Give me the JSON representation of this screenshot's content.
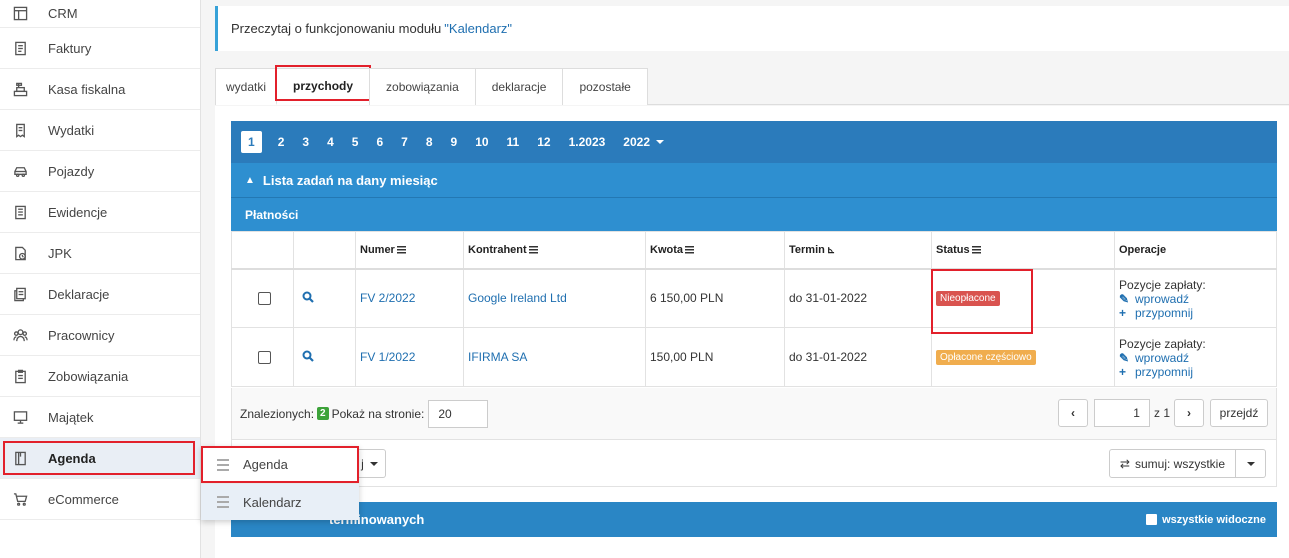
{
  "sidebar": {
    "items": [
      {
        "label": "CRM",
        "icon": "layout-icon"
      },
      {
        "label": "Faktury",
        "icon": "invoice-icon"
      },
      {
        "label": "Kasa fiskalna",
        "icon": "cash-register-icon"
      },
      {
        "label": "Wydatki",
        "icon": "receipt-icon"
      },
      {
        "label": "Pojazdy",
        "icon": "car-icon"
      },
      {
        "label": "Ewidencje",
        "icon": "ledger-icon"
      },
      {
        "label": "JPK",
        "icon": "jpk-file-icon"
      },
      {
        "label": "Deklaracje",
        "icon": "declaration-icon"
      },
      {
        "label": "Pracownicy",
        "icon": "employees-icon"
      },
      {
        "label": "Zobowiązania",
        "icon": "obligations-icon"
      },
      {
        "label": "Majątek",
        "icon": "monitor-icon"
      },
      {
        "label": "Agenda",
        "icon": "agenda-icon"
      },
      {
        "label": "eCommerce",
        "icon": "cart-icon"
      }
    ]
  },
  "submenu": {
    "items": [
      {
        "label": "Agenda"
      },
      {
        "label": "Kalendarz"
      }
    ]
  },
  "info": {
    "text": "Przeczytaj o funkcjonowaniu modułu",
    "link": "\"Kalendarz\""
  },
  "tabs": [
    {
      "label": "wydatki"
    },
    {
      "label": "przychody"
    },
    {
      "label": "zobowiązania"
    },
    {
      "label": "deklaracje"
    },
    {
      "label": "pozostałe"
    }
  ],
  "months": [
    "1",
    "2",
    "3",
    "4",
    "5",
    "6",
    "7",
    "8",
    "9",
    "10",
    "11",
    "12",
    "1.2023",
    "2022"
  ],
  "tasks_header": "Lista zadań na dany miesiąc",
  "payments_header": "Płatności",
  "table": {
    "columns": [
      "Numer",
      "Kontrahent",
      "Kwota",
      "Termin",
      "Status",
      "Operacje"
    ],
    "rows": [
      {
        "numer": "FV 2/2022",
        "kontrahent": "Google Ireland Ltd",
        "kwota": "6 150,00 PLN",
        "termin": "do 31-01-2022",
        "status": "Nieopłacone",
        "ops_title": "Pozycje zapłaty:",
        "op1": "wprowadź",
        "op2": "przypomnij"
      },
      {
        "numer": "FV 1/2022",
        "kontrahent": "IFIRMA SA",
        "kwota": "150,00 PLN",
        "termin": "do 31-01-2022",
        "status": "Opłacone częściowo",
        "ops_title": "Pozycje zapłaty:",
        "op1": "wprowadź",
        "op2": "przypomnij"
      }
    ]
  },
  "footer": {
    "found_label": "Znalezionych:",
    "found_count": "2",
    "per_page_label": "Pokaż na stronie:",
    "per_page_value": "20",
    "page_value": "1",
    "page_of": "z 1",
    "go_label": "przejdź"
  },
  "actions": {
    "bulk_fragment": "j",
    "sum_label": "sumuj: wszystkie"
  },
  "bottom": {
    "title_fragment": "terminowanych",
    "all_visible": "wszystkie widoczne"
  },
  "colors": {
    "accent": "#2a86c5",
    "highlight": "#e2202b",
    "badge_unpaid": "#d9534f",
    "badge_partial": "#f0ad4e",
    "count_badge": "#3da33a"
  }
}
